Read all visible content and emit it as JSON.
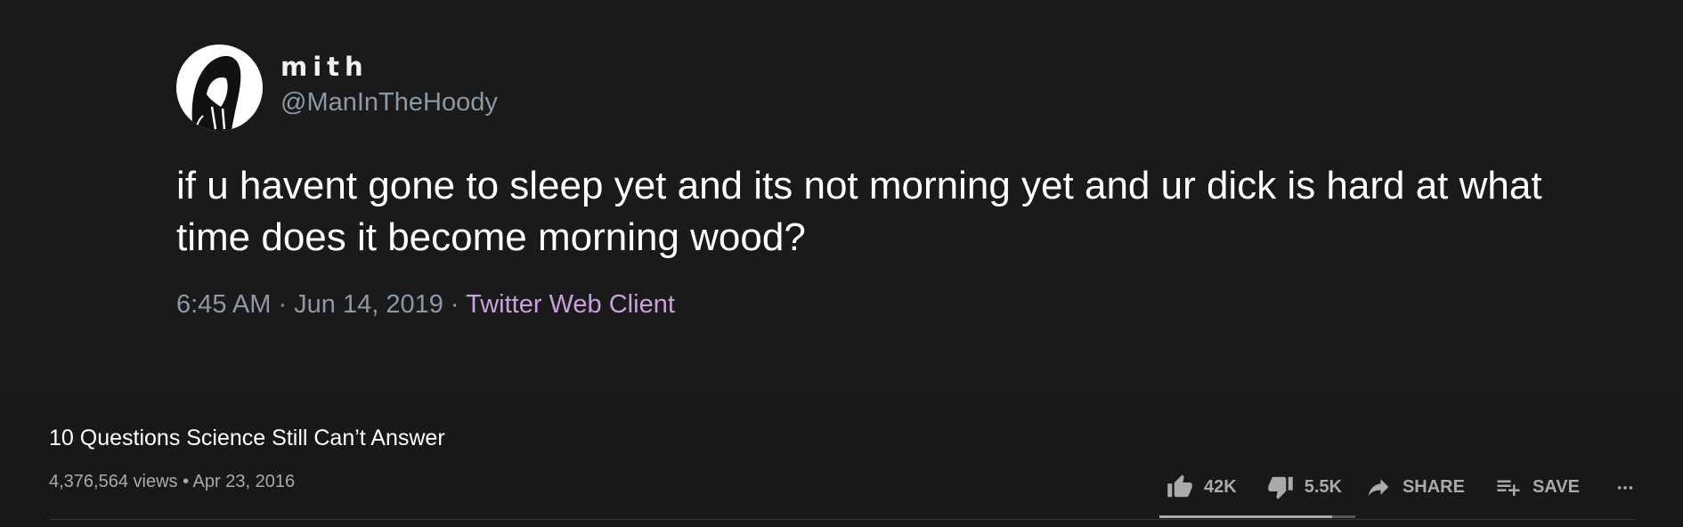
{
  "tweet": {
    "display_name": "mith",
    "handle": "@ManInTheHoody",
    "text": "if u havent gone to sleep yet and its not morning yet and ur dick is hard at what time does it become morning wood?",
    "timestamp": "6:45 AM · Jun 14, 2019 · ",
    "source": "Twitter Web Client",
    "avatar_icon": "hooded-figure-icon"
  },
  "video": {
    "title": "10 Questions Science Still Can’t Answer",
    "stats": "4,376,564 views • Apr 23, 2016",
    "like_count": "42K",
    "dislike_count": "5.5K",
    "share_label": "SHARE",
    "save_label": "SAVE",
    "like_ratio": 0.88
  },
  "colors": {
    "background": "#181818",
    "tweet_background": "#1a1a1b",
    "muted_text": "#8b98a5",
    "source_link": "#c9a0dc",
    "action_text": "#aaaaaa"
  }
}
